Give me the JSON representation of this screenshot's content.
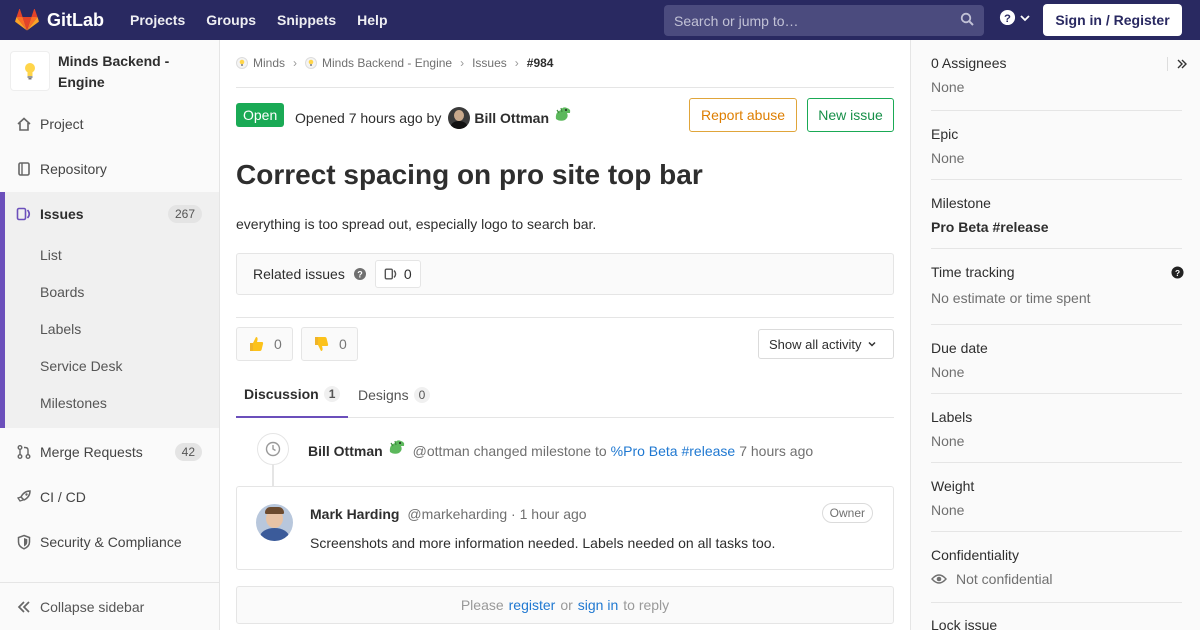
{
  "topbar": {
    "brand": "GitLab",
    "nav": [
      "Projects",
      "Groups",
      "Snippets",
      "Help"
    ],
    "search_placeholder": "Search or jump to…",
    "signin": "Sign in / Register"
  },
  "sidebar": {
    "project_name": "Minds Backend - Engine",
    "items": [
      {
        "label": "Project"
      },
      {
        "label": "Repository"
      },
      {
        "label": "Issues",
        "count": "267"
      },
      {
        "label": "Merge Requests",
        "count": "42"
      },
      {
        "label": "CI / CD"
      },
      {
        "label": "Security & Compliance"
      }
    ],
    "issue_sub": [
      "List",
      "Boards",
      "Labels",
      "Service Desk",
      "Milestones"
    ],
    "collapse": "Collapse sidebar"
  },
  "breadcrumb": [
    "Minds",
    "Minds Backend - Engine",
    "Issues",
    "#984"
  ],
  "issue": {
    "status": "Open",
    "opened_prefix": "Opened 7 hours ago by",
    "author": "Bill Ottman",
    "report_abuse": "Report abuse",
    "new_issue": "New issue",
    "title": "Correct spacing on pro site top bar",
    "description": "everything is too spread out, especially logo to search bar.",
    "related_label": "Related issues",
    "related_count": "0",
    "thumbs_up": "0",
    "thumbs_down": "0",
    "activity_filter": "Show all activity"
  },
  "tabs": [
    {
      "label": "Discussion",
      "count": "1"
    },
    {
      "label": "Designs",
      "count": "0"
    }
  ],
  "system_note": {
    "author": "Bill Ottman",
    "text": "@ottman changed milestone to",
    "milestone_link": "%Pro Beta #release",
    "time": "7 hours ago"
  },
  "comment": {
    "author": "Mark Harding",
    "meta": "@markeharding · 1 hour ago",
    "role": "Owner",
    "body": "Screenshots and more information needed. Labels needed on all tasks too."
  },
  "reply": {
    "please": "Please",
    "register": "register",
    "or": "or",
    "signin": "sign in",
    "to_reply": "to reply"
  },
  "right_sidebar": {
    "assignees_label": "0 Assignees",
    "assignees_value": "None",
    "epic_label": "Epic",
    "epic_value": "None",
    "milestone_label": "Milestone",
    "milestone_value": "Pro Beta #release",
    "time_label": "Time tracking",
    "time_value": "No estimate or time spent",
    "due_label": "Due date",
    "due_value": "None",
    "labels_label": "Labels",
    "labels_value": "None",
    "weight_label": "Weight",
    "weight_value": "None",
    "conf_label": "Confidentiality",
    "conf_value": "Not confidential",
    "lock_label": "Lock issue"
  }
}
